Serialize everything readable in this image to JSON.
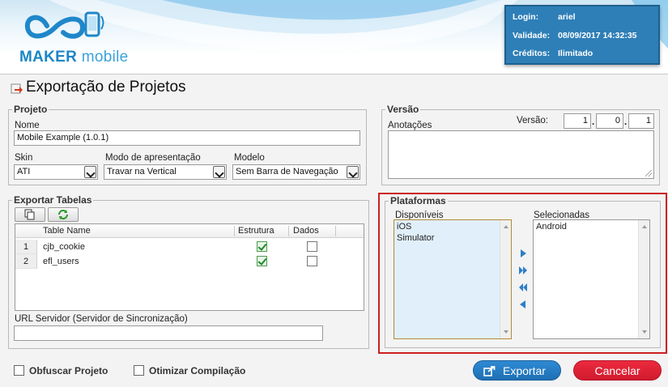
{
  "app": {
    "brand_main": "MAKER",
    "brand_sub": "mobile"
  },
  "login": {
    "login_label": "Login:",
    "login_value": "ariel",
    "validade_label": "Validade:",
    "validade_value": "08/09/2017 14:32:35",
    "creditos_label": "Créditos:",
    "creditos_value": "Ilimitado"
  },
  "page": {
    "title": "Exportação de Projetos"
  },
  "projeto": {
    "legend": "Projeto",
    "nome_label": "Nome",
    "nome_value": "Mobile Example (1.0.1)",
    "skin_label": "Skin",
    "skin_value": "ATI",
    "modo_label": "Modo de apresentação",
    "modo_value": "Travar na Vertical",
    "modelo_label": "Modelo",
    "modelo_value": "Sem Barra de Navegação"
  },
  "versao": {
    "legend": "Versão",
    "anotacoes_label": "Anotações",
    "versao_label": "Versão:",
    "major": "1",
    "minor": "0",
    "patch": "1"
  },
  "exportar_tabelas": {
    "legend": "Exportar Tabelas",
    "columns": {
      "name": "Table Name",
      "estrutura": "Estrutura",
      "dados": "Dados"
    },
    "rows": [
      {
        "num": "1",
        "name": "cjb_cookie",
        "estrutura": true,
        "dados": false
      },
      {
        "num": "2",
        "name": "efl_users",
        "estrutura": true,
        "dados": false
      }
    ],
    "url_label": "URL Servidor (Servidor de Sincronização)",
    "url_value": ""
  },
  "plataformas": {
    "legend": "Plataformas",
    "disponiveis_label": "Disponíveis",
    "disponiveis": [
      "iOS",
      "Simulator"
    ],
    "selecionadas_label": "Selecionadas",
    "selecionadas": [
      "Android"
    ]
  },
  "options": {
    "obfuscar_label": "Obfuscar Projeto",
    "obfuscar_checked": false,
    "otimizar_label": "Otimizar Compilação",
    "otimizar_checked": false
  },
  "actions": {
    "exportar_label": "Exportar",
    "cancelar_label": "Cancelar"
  },
  "colors": {
    "accent": "#2e7fb7",
    "danger": "#d11a2e",
    "highlight_frame": "#cc1f1f"
  }
}
